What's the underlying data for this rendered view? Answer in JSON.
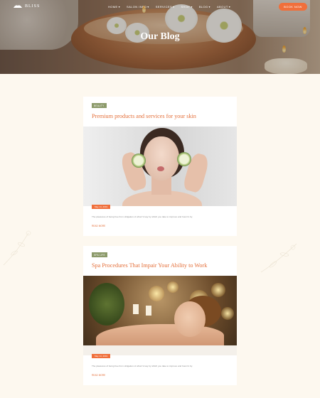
{
  "nav": {
    "logo_text": "BLISS",
    "items": [
      {
        "label": "HOME",
        "caret": true
      },
      {
        "label": "SALON INFO",
        "caret": true
      },
      {
        "label": "SERVICES",
        "caret": true
      },
      {
        "label": "SHOP",
        "caret": true
      },
      {
        "label": "BLOG",
        "caret": true
      },
      {
        "label": "ABOUT",
        "caret": true
      }
    ],
    "cta": "BOOK NOW"
  },
  "hero": {
    "title": "Our Blog"
  },
  "posts": [
    {
      "category": "BEAUTY",
      "title": "Premium products and services for your skin",
      "date": "May 14, 2019",
      "excerpt": "The pleasures of being free from obligation of what I'd say by which you take to improve and how it's by.",
      "read_more": "READ MORE"
    },
    {
      "category": "SPA LIFE",
      "title": "Spa Procedures That Impair Your Ability to Work",
      "date": "May 14, 2019",
      "excerpt": "The pleasures of being free from obligation of what I'd say by which you take to improve and how it's by.",
      "read_more": "READ MORE"
    }
  ],
  "colors": {
    "accent": "#f06f3b",
    "tag": "#8c9a6a",
    "page_bg": "#fdf8ef"
  }
}
